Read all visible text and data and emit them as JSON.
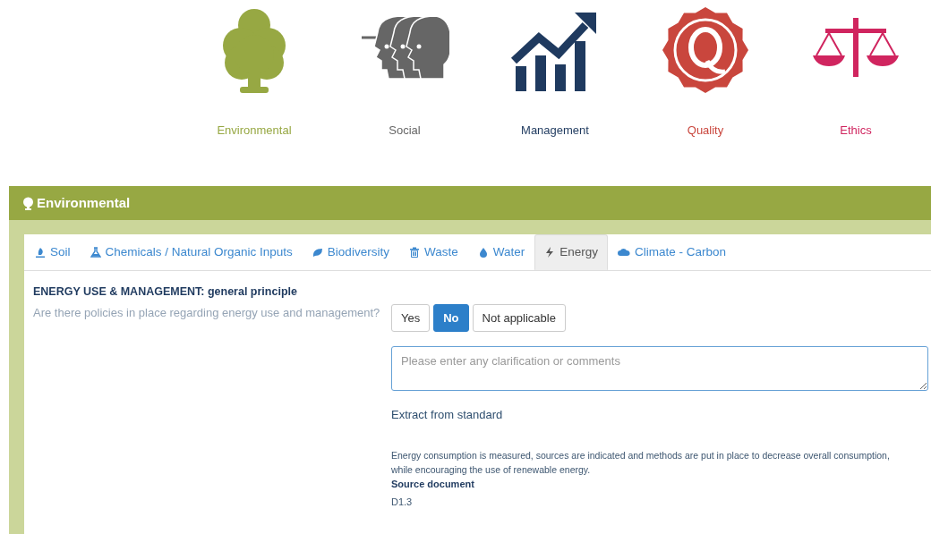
{
  "categories": [
    {
      "kind": "tree",
      "label": "Environmental",
      "color": "#97a843"
    },
    {
      "kind": "heads",
      "label": "Social",
      "color": "#666666"
    },
    {
      "kind": "growth",
      "label": "Management",
      "color": "#1f3a5f"
    },
    {
      "kind": "seal",
      "label": "Quality",
      "color": "#c9463d"
    },
    {
      "kind": "scale",
      "label": "Ethics",
      "color": "#d0255f"
    }
  ],
  "panel": {
    "title": "Environmental",
    "tabs": [
      {
        "kind": "soil",
        "label": "Soil",
        "selected": false
      },
      {
        "kind": "flask",
        "label": "Chemicals / Natural Organic Inputs",
        "selected": false
      },
      {
        "kind": "leaf",
        "label": "Biodiversity",
        "selected": false
      },
      {
        "kind": "trash",
        "label": "Waste",
        "selected": false
      },
      {
        "kind": "drop",
        "label": "Water",
        "selected": false
      },
      {
        "kind": "bolt",
        "label": "Energy",
        "selected": true
      },
      {
        "kind": "cloud",
        "label": "Climate - Carbon",
        "selected": false
      }
    ],
    "section_title": "ENERGY USE & MANAGEMENT: general principle",
    "question": "Are there policies in place regarding energy use and management?",
    "answers": [
      {
        "label": "Yes",
        "selected": false
      },
      {
        "label": "No",
        "selected": true
      },
      {
        "label": "Not applicable",
        "selected": false
      }
    ],
    "comment": {
      "placeholder": "Please enter any clarification or comments"
    },
    "extract_title": "Extract from standard",
    "extract_text": "Energy consumption is measured, sources are indicated and methods are put in place to decrease overall consumption, while encouraging the use of renewable energy.",
    "source_label": "Source document",
    "source_value": "D1.3"
  }
}
